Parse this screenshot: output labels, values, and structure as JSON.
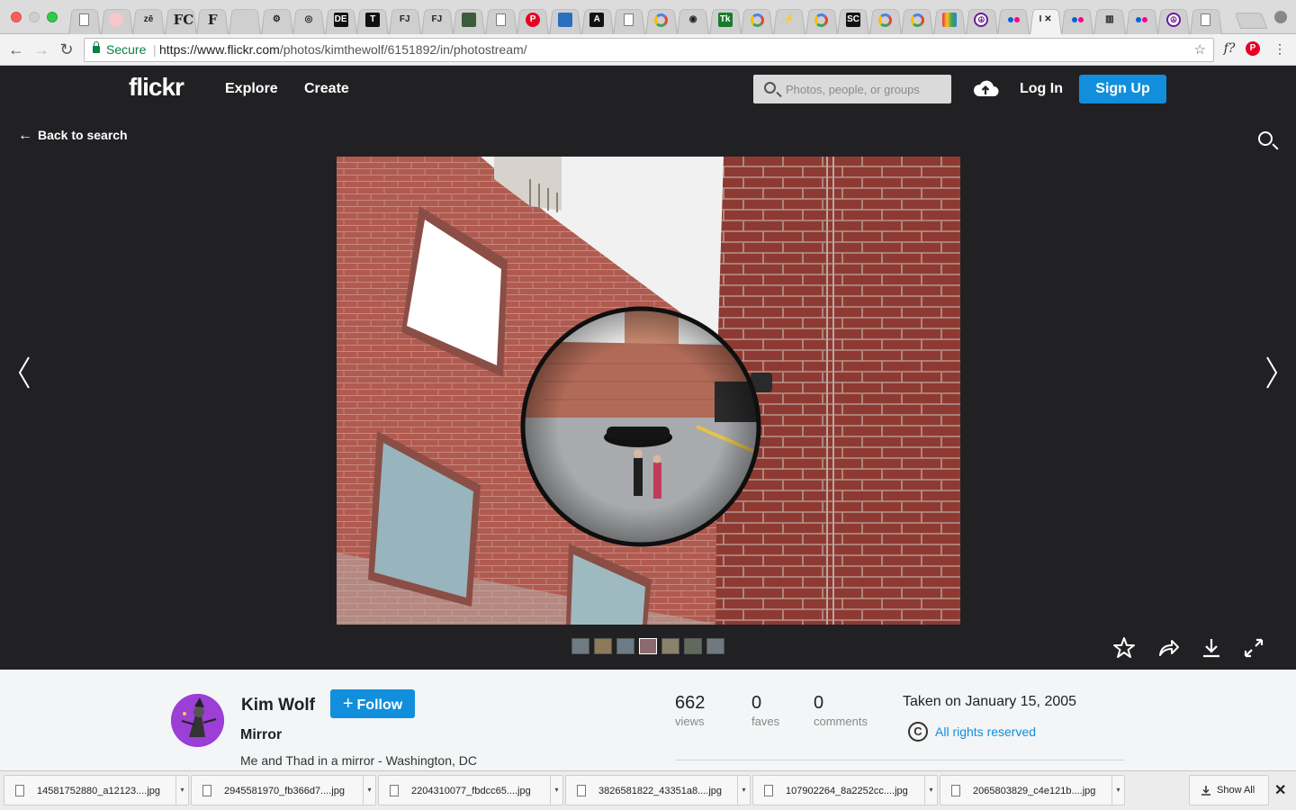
{
  "browser": {
    "tabs": [
      {
        "icon": "doc-icon",
        "label": ""
      },
      {
        "icon": "pink-circle-icon",
        "label": ""
      },
      {
        "icon": "zen-icon",
        "label": "zē"
      },
      {
        "icon": "fc-icon",
        "label": "FC"
      },
      {
        "icon": "f-icon",
        "label": "F"
      },
      {
        "icon": "tree-icon",
        "label": ""
      },
      {
        "icon": "gear-icon",
        "label": "⚙"
      },
      {
        "icon": "seal-icon",
        "label": "◎"
      },
      {
        "icon": "de-icon",
        "label": "DE"
      },
      {
        "icon": "t-icon",
        "label": "T"
      },
      {
        "icon": "fj-icon",
        "label": "FJ"
      },
      {
        "icon": "fj-icon",
        "label": "FJ"
      },
      {
        "icon": "map-icon",
        "label": ""
      },
      {
        "icon": "doc-icon",
        "label": ""
      },
      {
        "icon": "pinterest-icon",
        "label": "P"
      },
      {
        "icon": "blue-doc-icon",
        "label": ""
      },
      {
        "icon": "a-icon",
        "label": "A"
      },
      {
        "icon": "doc-icon",
        "label": ""
      },
      {
        "icon": "google-icon",
        "label": ""
      },
      {
        "icon": "eye-icon",
        "label": "◉"
      },
      {
        "icon": "tk-icon",
        "label": "Tk"
      },
      {
        "icon": "google-icon",
        "label": ""
      },
      {
        "icon": "bolt-icon",
        "label": "⚡"
      },
      {
        "icon": "google-icon",
        "label": ""
      },
      {
        "icon": "sc-icon",
        "label": "SC"
      },
      {
        "icon": "google-icon",
        "label": ""
      },
      {
        "icon": "google-icon",
        "label": ""
      },
      {
        "icon": "tv-icon",
        "label": ""
      },
      {
        "icon": "peace-icon",
        "label": "☮"
      },
      {
        "icon": "flickr-icon",
        "label": ""
      },
      {
        "icon": "active-tab-icon",
        "label": "I ✕"
      },
      {
        "icon": "flickr-icon",
        "label": ""
      },
      {
        "icon": "archive-icon",
        "label": "▥"
      },
      {
        "icon": "flickr-icon",
        "label": ""
      },
      {
        "icon": "peace-icon",
        "label": "☮"
      },
      {
        "icon": "doc-icon",
        "label": ""
      }
    ],
    "secure_label": "Secure",
    "url_host": "https://www.flickr.com",
    "url_path": "/photos/kimthewolf/6151892/in/photostream/",
    "ext_font_label": "f?",
    "ext_pinterest_label": "P"
  },
  "header": {
    "logo": "flickr",
    "nav": [
      "Explore",
      "Create"
    ],
    "search_placeholder": "Photos, people, or groups",
    "login": "Log In",
    "signup": "Sign Up"
  },
  "photo_view": {
    "back_label": "Back to search",
    "thumbnail_count": 7,
    "current_thumbnail_index": 3
  },
  "info": {
    "owner": "Kim Wolf",
    "follow_label": "Follow",
    "title": "Mirror",
    "description": "Me and Thad in a mirror - Washington, DC",
    "stats": [
      {
        "value": "662",
        "label": "views"
      },
      {
        "value": "0",
        "label": "faves"
      },
      {
        "value": "0",
        "label": "comments"
      }
    ],
    "taken": "Taken on January 15, 2005",
    "copyright_symbol": "C",
    "rights": "All rights reserved"
  },
  "downloads": {
    "files": [
      "14581752880_a12123....jpg",
      "2945581970_fb366d7....jpg",
      "2204310077_fbdcc65....jpg",
      "3826581822_43351a8....jpg",
      "107902264_8a2252cc....jpg",
      "2065803829_c4e121b....jpg"
    ],
    "show_all": "Show All"
  }
}
